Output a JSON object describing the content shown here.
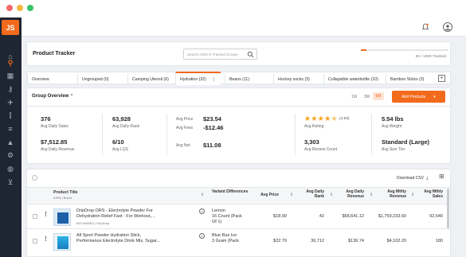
{
  "window": {
    "dots": [
      "#f26a6a",
      "#f6b73c",
      "#39c16c"
    ]
  },
  "sidebar": {
    "logo": "JS"
  },
  "header": {
    "title": "Product Tracker",
    "search_placeholder": "Search ASIN in Tracked Groups",
    "tracked_text": "60 / 1000 Tracked",
    "tracked_progress": 0.06
  },
  "tabs": [
    {
      "label": "Overview"
    },
    {
      "label": "Ungrouped (0)"
    },
    {
      "label": "Camping Utensil (6)"
    },
    {
      "label": "Hydration (32)"
    },
    {
      "label": "Beans (11)"
    },
    {
      "label": "Hockey socks (3)"
    },
    {
      "label": "Collapsible waterbottle (10)"
    },
    {
      "label": "Bamboo Sticks (3)"
    }
  ],
  "group_overview": {
    "title": "Group Overview",
    "ranges": [
      "1M",
      "3M",
      "6M"
    ],
    "add_products": "Add Products",
    "metrics": {
      "avg_daily_sales": "376",
      "avg_daily_sales_lbl": "Avg Daily Sales",
      "avg_daily_revenue": "$7,512.85",
      "avg_daily_revenue_lbl": "Avg Daily Revenue",
      "avg_daily_rank": "63,928",
      "avg_daily_rank_lbl": "Avg Daily Rank",
      "avg_lqs": "6/10",
      "avg_lqs_lbl": "Avg LQS",
      "avg_price_lbl": "Avg Price",
      "avg_price": "$23.54",
      "avg_fees_lbl": "Avg Fees",
      "avg_fees": "-$12.46",
      "avg_net_lbl": "Avg Net",
      "avg_net": "$11.08",
      "rating_value": "(4.53)",
      "rating_stars": 4.5,
      "avg_rating_lbl": "Avg Rating",
      "review_count": "3,303",
      "review_count_lbl": "Avg Review Count",
      "weight": "5.54 lbs",
      "weight_lbl": "Avg Weight",
      "size_tier": "Standard (Large)",
      "size_tier_lbl": "Avg Size Tier"
    }
  },
  "table": {
    "download": "Download CSV",
    "headers": {
      "title": "Product Title",
      "title_sub": "ASIN | Brand",
      "variant": "Variant Differences",
      "price": "Avg Price",
      "rank": "Avg Daily Rank",
      "revenue": "Avg Daily Revenue",
      "mrevenue": "Avg Mthly Revenue",
      "msales": "Avg Mthly Sales"
    },
    "rows": [
      {
        "title1": "DripDrop ORS - Electrolyte Powder For",
        "title2": "Dehydration Relief Fast - For Workout,...",
        "asin": "B07XMMNX | DripDrop",
        "variant1": "Lemon",
        "variant2": "16 Count (Pack",
        "variant3": "Of 1)",
        "price": "$18.99",
        "rank": "42",
        "revenue": "$58,641.12",
        "mrevenue": "$1,759,233.60",
        "msales": "92,640"
      },
      {
        "title1": "All Sport Powder Hydration Stick,",
        "title2": "Performance Electrolyte Drink Mix, Sugar...",
        "variant1": "Blue Raz Ice",
        "variant2": "3 Gram (Pack",
        "price": "$22.79",
        "rank": "36,712",
        "revenue": "$136.74",
        "mrevenue": "$4,102.20",
        "msales": "180"
      }
    ]
  }
}
